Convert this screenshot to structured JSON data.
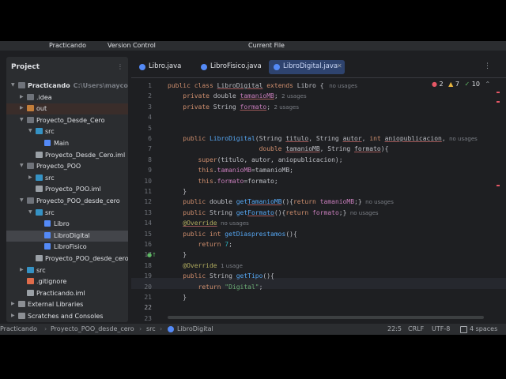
{
  "titlebar": {
    "project": "Practicando",
    "vcs": "Version Control",
    "run_config": "Current File"
  },
  "project_pane": {
    "title": "Project",
    "tree": [
      {
        "label": "Practicando",
        "hint": "C:\\Users\\mayco\\de",
        "type": "folder",
        "depth": 0,
        "expanded": true,
        "bold": true
      },
      {
        "label": ".idea",
        "type": "folder",
        "depth": 1,
        "expanded": false
      },
      {
        "label": "out",
        "type": "folder-out",
        "depth": 1,
        "expanded": false,
        "hilite": true
      },
      {
        "label": "Proyecto_Desde_Cero",
        "type": "folder",
        "depth": 1,
        "expanded": true
      },
      {
        "label": "src",
        "type": "folder-src",
        "depth": 2,
        "expanded": true
      },
      {
        "label": "Main",
        "type": "java",
        "depth": 3
      },
      {
        "label": "Proyecto_Desde_Cero.iml",
        "type": "iml",
        "depth": 2
      },
      {
        "label": "Proyecto_POO",
        "type": "folder",
        "depth": 1,
        "expanded": true
      },
      {
        "label": "src",
        "type": "folder-src",
        "depth": 2,
        "expanded": false
      },
      {
        "label": "Proyecto_POO.iml",
        "type": "iml",
        "depth": 2
      },
      {
        "label": "Proyecto_POO_desde_cero",
        "type": "folder",
        "depth": 1,
        "expanded": true
      },
      {
        "label": "src",
        "type": "folder-src",
        "depth": 2,
        "expanded": true
      },
      {
        "label": "Libro",
        "type": "java",
        "depth": 3
      },
      {
        "label": "LibroDigital",
        "type": "java",
        "depth": 3,
        "selected": true
      },
      {
        "label": "LibroFisico",
        "type": "java",
        "depth": 3
      },
      {
        "label": "Proyecto_POO_desde_cero.",
        "type": "iml",
        "depth": 2
      },
      {
        "label": "src",
        "type": "folder-src",
        "depth": 1,
        "expanded": false
      },
      {
        "label": ".gitignore",
        "type": "git",
        "depth": 1
      },
      {
        "label": "Practicando.iml",
        "type": "iml",
        "depth": 1
      },
      {
        "label": "External Libraries",
        "type": "lib",
        "depth": 0,
        "expanded": false
      },
      {
        "label": "Scratches and Consoles",
        "type": "lib",
        "depth": 0,
        "expanded": false
      }
    ]
  },
  "editor": {
    "tabs": [
      {
        "label": "Libro.java",
        "active": false
      },
      {
        "label": "LibroFisico.java",
        "active": false
      },
      {
        "label": "LibroDigital.java",
        "active": true
      }
    ],
    "inspections": {
      "errors": "2",
      "warnings": "7",
      "ok": "10"
    },
    "line_numbers": [
      "1",
      "2",
      "3",
      "4",
      "5",
      "6",
      "7",
      "8",
      "9",
      "10",
      "11",
      "12",
      "13",
      "14",
      "15",
      "16",
      "17",
      "18",
      "19",
      "20",
      "21",
      "22",
      "23"
    ],
    "current_line": "22",
    "lines": [
      {
        "i": 0,
        "tokens": [
          [
            "kw",
            "public class "
          ],
          [
            "cls uline",
            "LibroDigital"
          ],
          [
            "kw",
            " extends "
          ],
          [
            "cls",
            "Libro "
          ],
          [
            "ty",
            "{"
          ],
          [
            "hint",
            "   no usages"
          ]
        ]
      },
      {
        "i": 1,
        "tokens": [
          [
            "ty",
            "    "
          ],
          [
            "kw",
            "private "
          ],
          [
            "ty",
            "double "
          ],
          [
            "fld uline",
            "tamanioMB"
          ],
          [
            "ty",
            ";"
          ],
          [
            "hint",
            "  2 usages"
          ]
        ]
      },
      {
        "i": 2,
        "tokens": [
          [
            "ty",
            "    "
          ],
          [
            "kw",
            "private "
          ],
          [
            "ty",
            "String "
          ],
          [
            "fld uline",
            "formato"
          ],
          [
            "ty",
            ";"
          ],
          [
            "hint",
            "  2 usages"
          ]
        ]
      },
      {
        "i": 3,
        "tokens": []
      },
      {
        "i": 4,
        "tokens": []
      },
      {
        "i": 5,
        "tokens": [
          [
            "ty",
            "    "
          ],
          [
            "kw",
            "public "
          ],
          [
            "fn",
            "LibroDigital"
          ],
          [
            "ty",
            "(String "
          ],
          [
            "uline",
            "titulo"
          ],
          [
            "ty",
            ", String "
          ],
          [
            "uline",
            "autor"
          ],
          [
            "ty",
            ", "
          ],
          [
            "kw",
            "int "
          ],
          [
            "uline",
            "aniopublicacion"
          ],
          [
            "ty",
            ","
          ],
          [
            "hint",
            "  no usages"
          ]
        ]
      },
      {
        "i": 6,
        "tokens": [
          [
            "ty",
            "                        "
          ],
          [
            "kw",
            "double "
          ],
          [
            "uline",
            "tamanioMB"
          ],
          [
            "ty",
            ", String "
          ],
          [
            "uline",
            "formato"
          ],
          [
            "ty",
            "){"
          ]
        ]
      },
      {
        "i": 7,
        "tokens": [
          [
            "ty",
            "        "
          ],
          [
            "kw",
            "super"
          ],
          [
            "ty",
            "(titulo, autor, aniopublicacion);"
          ]
        ]
      },
      {
        "i": 8,
        "tokens": [
          [
            "ty",
            "        "
          ],
          [
            "kw",
            "this"
          ],
          [
            "ty",
            "."
          ],
          [
            "fld",
            "tamanioMB"
          ],
          [
            "ty",
            "=tamanioMB;"
          ]
        ]
      },
      {
        "i": 9,
        "tokens": [
          [
            "ty",
            "        "
          ],
          [
            "kw",
            "this"
          ],
          [
            "ty",
            "."
          ],
          [
            "fld",
            "formato"
          ],
          [
            "ty",
            "=formato;"
          ]
        ]
      },
      {
        "i": 10,
        "tokens": [
          [
            "ty",
            "    }"
          ]
        ]
      },
      {
        "i": 11,
        "tokens": [
          [
            "ty",
            "    "
          ],
          [
            "kw",
            "public "
          ],
          [
            "ty",
            "double "
          ],
          [
            "fn",
            "get"
          ],
          [
            "fn uline",
            "TamanioMB"
          ],
          [
            "ty",
            "(){"
          ],
          [
            "kw",
            "return "
          ],
          [
            "fld",
            "tamanioMB"
          ],
          [
            "ty",
            ";}"
          ],
          [
            "hint",
            "  no usages"
          ]
        ]
      },
      {
        "i": 12,
        "tokens": [
          [
            "ty",
            "    "
          ],
          [
            "kw",
            "public "
          ],
          [
            "ty",
            "String "
          ],
          [
            "fn",
            "get"
          ],
          [
            "fn uline",
            "Formato"
          ],
          [
            "ty",
            "(){"
          ],
          [
            "kw",
            "return "
          ],
          [
            "fld",
            "formato"
          ],
          [
            "ty",
            ";}"
          ],
          [
            "hint",
            "  no usages"
          ]
        ]
      },
      {
        "i": 13,
        "tokens": [
          [
            "ty",
            "    "
          ],
          [
            "ann uline",
            "@Override"
          ],
          [
            "hint",
            "  no usages"
          ]
        ]
      },
      {
        "i": 14,
        "tokens": [
          [
            "ty",
            "    "
          ],
          [
            "kw",
            "public "
          ],
          [
            "kw",
            "int "
          ],
          [
            "fn",
            "getDiasprestamos"
          ],
          [
            "ty",
            "(){"
          ]
        ]
      },
      {
        "i": 15,
        "tokens": [
          [
            "ty",
            "        "
          ],
          [
            "kw",
            "return "
          ],
          [
            "num",
            "7"
          ],
          [
            "ty",
            ";"
          ]
        ]
      },
      {
        "i": 16,
        "tokens": [
          [
            "ty",
            "    }"
          ]
        ]
      },
      {
        "i": 17,
        "tokens": [
          [
            "ty",
            "    "
          ],
          [
            "ann",
            "@Override"
          ],
          [
            "hint",
            "  1 usage"
          ]
        ]
      },
      {
        "i": 18,
        "tokens": [
          [
            "ty",
            "    "
          ],
          [
            "kw",
            "public "
          ],
          [
            "ty",
            "String "
          ],
          [
            "fn",
            "getTipo"
          ],
          [
            "ty",
            "(){"
          ]
        ]
      },
      {
        "i": 19,
        "tokens": [
          [
            "ty",
            "        "
          ],
          [
            "kw",
            "return "
          ],
          [
            "str",
            "\"Digital\""
          ],
          [
            "ty",
            ";"
          ]
        ]
      },
      {
        "i": 20,
        "tokens": [
          [
            "ty",
            "    }"
          ]
        ]
      },
      {
        "i": 21,
        "tokens": []
      },
      {
        "i": 22,
        "tokens": []
      }
    ]
  },
  "statusbar": {
    "breadcrumb": [
      "Practicando",
      "Proyecto_POO_desde_cero",
      "src",
      "LibroDigital"
    ],
    "position": "22:5",
    "line_ending": "CRLF",
    "encoding": "UTF-8",
    "indent": "4 spaces"
  },
  "colors": {
    "background": "#1e1f22",
    "panel": "#2b2d30",
    "accent": "#2e436e",
    "keyword": "#cf8e6d",
    "function": "#56a8f5",
    "field": "#c77dbb",
    "string": "#6aab73",
    "error": "#e55765"
  },
  "icons": [
    "settings-gear-icon",
    "close-icon",
    "more-vertical-icon",
    "folder-icon",
    "java-class-icon",
    "run-gutter-icon",
    "error-icon",
    "warning-icon",
    "check-icon"
  ]
}
